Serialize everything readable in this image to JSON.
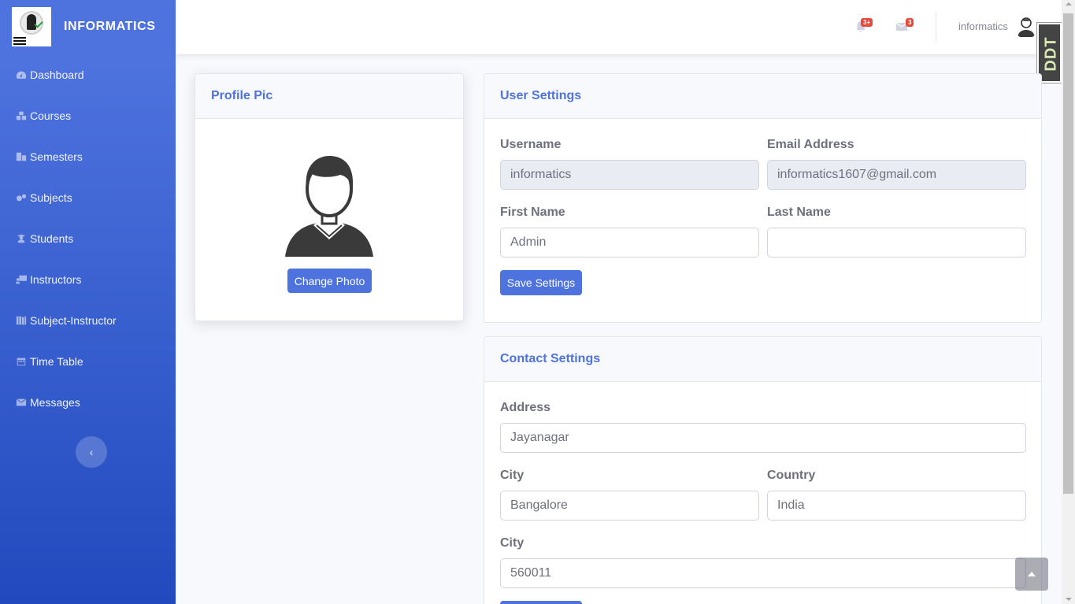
{
  "brand": {
    "name": "INFORMATICS"
  },
  "sidebar": {
    "items": [
      {
        "label": "Dashboard",
        "icon": "tachometer-icon"
      },
      {
        "label": "Courses",
        "icon": "cubes-icon"
      },
      {
        "label": "Semesters",
        "icon": "building-icon"
      },
      {
        "label": "Subjects",
        "icon": "cogs-icon"
      },
      {
        "label": "Students",
        "icon": "user-graduate-icon"
      },
      {
        "label": "Instructors",
        "icon": "chalkboard-teacher-icon"
      },
      {
        "label": "Subject-Instructor",
        "icon": "book-icon"
      },
      {
        "label": "Time Table",
        "icon": "calendar-icon"
      },
      {
        "label": "Messages",
        "icon": "envelope-icon"
      }
    ],
    "toggle_icon": "chevron-left-icon"
  },
  "topbar": {
    "alerts_badge": "3+",
    "messages_badge": "3",
    "username": "informatics"
  },
  "overlay": {
    "badge_text": "DDT"
  },
  "profile_card": {
    "title": "Profile Pic",
    "change_photo_label": "Change Photo"
  },
  "user_settings": {
    "title": "User Settings",
    "username_label": "Username",
    "username_value": "informatics",
    "email_label": "Email Address",
    "email_value": "informatics1607@gmail.com",
    "first_name_label": "First Name",
    "first_name_value": "Admin",
    "last_name_label": "Last Name",
    "last_name_value": "",
    "save_label": "Save Settings"
  },
  "contact_settings": {
    "title": "Contact Settings",
    "address_label": "Address",
    "address_value": "Jayanagar",
    "city_label": "City",
    "city_value": "Bangalore",
    "country_label": "Country",
    "country_value": "India",
    "postal_label": "City",
    "postal_value": "560011"
  },
  "colors": {
    "primary": "#4e73df",
    "danger": "#e74a3b",
    "sidebar_gradient_end": "#224abe"
  }
}
